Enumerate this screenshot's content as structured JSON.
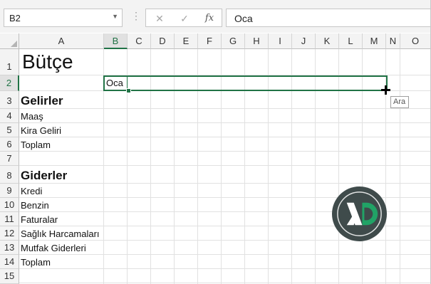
{
  "formula_bar": {
    "name_box": "B2",
    "input_value": "Oca"
  },
  "columns": [
    "A",
    "B",
    "C",
    "D",
    "E",
    "F",
    "G",
    "H",
    "I",
    "J",
    "K",
    "L",
    "M",
    "N",
    "O"
  ],
  "selected_column": "B",
  "rows": [
    "1",
    "2",
    "3",
    "4",
    "5",
    "6",
    "7",
    "8",
    "9",
    "10",
    "11",
    "12",
    "13",
    "14",
    "15"
  ],
  "selected_row": "2",
  "cells": {
    "A1": "Bütçe",
    "B2": "Oca",
    "A3": "Gelirler",
    "A4": "Maaş",
    "A5": "Kira Geliri",
    "A6": "Toplam",
    "A8": "Giderler",
    "A9": "Kredi",
    "A10": "Benzin",
    "A11": "Faturalar",
    "A12": "Sağlık Harcamaları",
    "A13": "Mutfak Giderleri",
    "A14": "Toplam"
  },
  "drag_tooltip": "Ara",
  "colors": {
    "accent": "#217346",
    "logo_ring": "#3f4b4b",
    "logo_green": "#21a366"
  },
  "icons": {
    "name_box_dropdown": "chevron-down-icon",
    "cancel": "close-icon",
    "enter": "check-icon",
    "function": "fx-icon",
    "cursor": "crosshair-icon",
    "logo": "xd-logo"
  }
}
